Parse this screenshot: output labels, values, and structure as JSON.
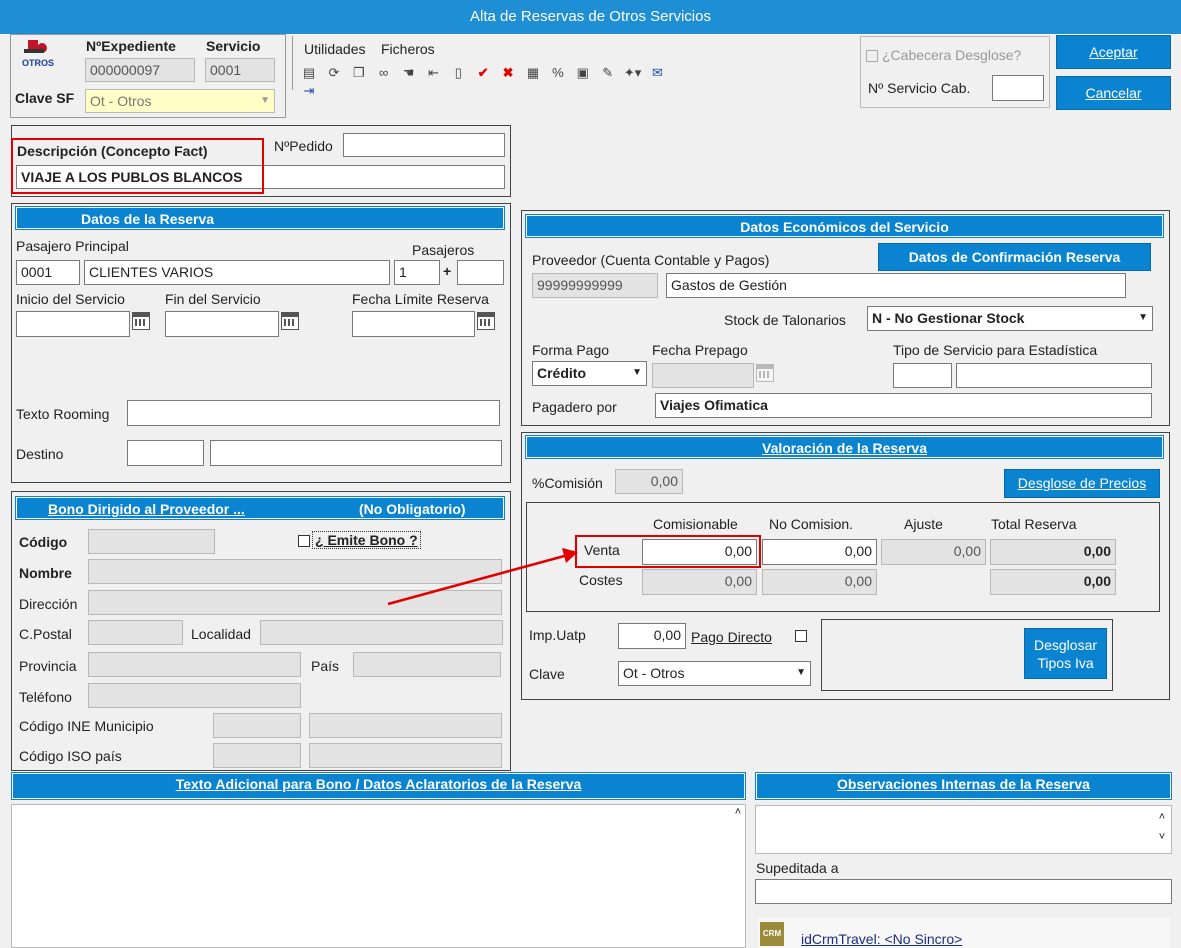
{
  "window": {
    "title": "Alta de Reservas de Otros Servicios"
  },
  "header": {
    "logo_text": "OTROS",
    "expediente_label": "NºExpediente",
    "expediente_value": "000000097",
    "servicio_label": "Servicio",
    "servicio_value": "0001",
    "clave_sf_label": "Clave SF",
    "clave_sf_value": "Ot - Otros"
  },
  "menu": {
    "utilidades": "Utilidades",
    "ficheros": "Ficheros"
  },
  "cabecera": {
    "checkbox_label": "¿Cabecera Desglose?",
    "servicio_cab_label": "Nº Servicio Cab.",
    "servicio_cab_value": ""
  },
  "actions": {
    "aceptar": "Aceptar",
    "cancelar": "Cancelar"
  },
  "descripcion": {
    "label": "Descripción (Concepto Fact)",
    "value": "VIAJE A LOS PUBLOS BLANCOS",
    "pedido_label": "NºPedido",
    "pedido_value": ""
  },
  "datos_reserva": {
    "title": "Datos de la Reserva",
    "pasajero_label": "Pasajero Principal",
    "pasajero_code": "0001",
    "pasajero_name": "CLIENTES VARIOS",
    "pasajeros_label": "Pasajeros",
    "pasajeros_value": "1",
    "pasajeros_plus": "+",
    "pasajeros_extra": "",
    "inicio_label": "Inicio del Servicio",
    "fin_label": "Fin del Servicio",
    "limite_label": "Fecha Límite Reserva",
    "inicio_value": "",
    "fin_value": "",
    "limite_value": "",
    "rooming_label": "Texto Rooming",
    "rooming_value": "",
    "destino_label": "Destino",
    "destino_code": "",
    "destino_name": ""
  },
  "bono": {
    "title": "Bono Dirigido al Proveedor ...",
    "subtitle": "(No Obligatorio)",
    "codigo_label": "Código",
    "emite_label": "¿ Emite Bono ?",
    "nombre_label": "Nombre",
    "direccion_label": "Dirección",
    "cpostal_label": "C.Postal",
    "localidad_label": "Localidad",
    "provincia_label": "Provincia",
    "pais_label": "País",
    "telefono_label": "Teléfono",
    "ine_label": "Código INE Municipio",
    "iso_label": "Código ISO país"
  },
  "economicos": {
    "title": "Datos Económicos del Servicio",
    "confirmacion_button": "Datos de Confirmación Reserva",
    "proveedor_label": "Proveedor (Cuenta Contable y Pagos)",
    "proveedor_code": "99999999999",
    "proveedor_name": "Gastos de Gestión",
    "stock_label": "Stock de Talonarios",
    "stock_value": "N - No Gestionar Stock",
    "forma_pago_label": "Forma Pago",
    "forma_pago_value": "Crédito",
    "fecha_prepago_label": "Fecha Prepago",
    "tipo_servicio_label": "Tipo de Servicio para Estadística",
    "pagadero_label": "Pagadero por",
    "pagadero_value": "Viajes Ofimatica"
  },
  "valoracion": {
    "title": "Valoración de la Reserva",
    "comision_label": "%Comisión",
    "comision_value": "0,00",
    "desglose_precios_button": "Desglose de Precios",
    "columns": [
      "Comisionable",
      "No Comision.",
      "Ajuste",
      "Total Reserva"
    ],
    "venta_label": "Venta",
    "venta_values": [
      "0,00",
      "0,00",
      "0,00",
      "0,00"
    ],
    "costes_label": "Costes",
    "costes_values": [
      "0,00",
      "0,00",
      "0,00"
    ],
    "imp_uatp_label": "Imp.Uatp",
    "imp_uatp_value": "0,00",
    "pago_directo_label": "Pago Directo",
    "clave_label": "Clave",
    "clave_value": "Ot - Otros",
    "desglosar_button_line1": "Desglosar",
    "desglosar_button_line2": "Tipos Iva"
  },
  "texto_adicional": {
    "title": "Texto Adicional para Bono / Datos Aclaratorios de la Reserva"
  },
  "observaciones": {
    "title": "Observaciones Internas de la Reserva",
    "supeditada_label": "Supeditada a",
    "crm_text": "idCrmTravel: <No Sincro>",
    "crm_logo_text": "CRM"
  },
  "colors": {
    "accent_blue": "#0a84d0",
    "annotation_red": "#e00000",
    "title_blue": "#1e8fd5"
  }
}
